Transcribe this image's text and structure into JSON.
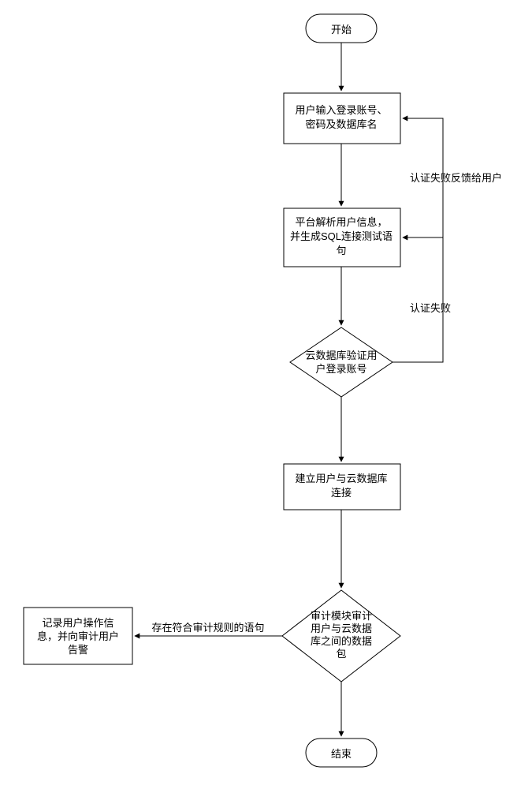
{
  "chart_data": {
    "type": "flowchart",
    "nodes": {
      "start": {
        "shape": "terminator",
        "text": "开始"
      },
      "input": {
        "shape": "process",
        "lines": [
          "用户输入登录账号、",
          "密码及数据库名"
        ]
      },
      "parse": {
        "shape": "process",
        "lines": [
          "平台解析用户信息，",
          "并生成SQL连接测试语",
          "句"
        ]
      },
      "verify": {
        "shape": "decision",
        "lines": [
          "云数据库验证用",
          "户登录账号"
        ]
      },
      "connect": {
        "shape": "process",
        "lines": [
          "建立用户与云数据库",
          "连接"
        ]
      },
      "audit": {
        "shape": "decision",
        "lines": [
          "审计模块审计",
          "用户与云数据",
          "库之间的数据",
          "包"
        ]
      },
      "record": {
        "shape": "process",
        "lines": [
          "记录用户操作信",
          "息，并向审计用户",
          "告警"
        ]
      },
      "end": {
        "shape": "terminator",
        "text": "结束"
      }
    },
    "edges": [
      {
        "from": "start",
        "to": "input"
      },
      {
        "from": "input",
        "to": "parse"
      },
      {
        "from": "parse",
        "to": "verify"
      },
      {
        "from": "verify",
        "to": "connect"
      },
      {
        "from": "connect",
        "to": "audit"
      },
      {
        "from": "audit",
        "to": "end"
      },
      {
        "from": "audit",
        "to": "record",
        "label": "存在符合审计规则的语句"
      },
      {
        "from": "verify",
        "to": "parse",
        "label": "认证失败"
      },
      {
        "from": "parse",
        "to": "input",
        "label": "认证失败反馈给用户"
      }
    ]
  }
}
